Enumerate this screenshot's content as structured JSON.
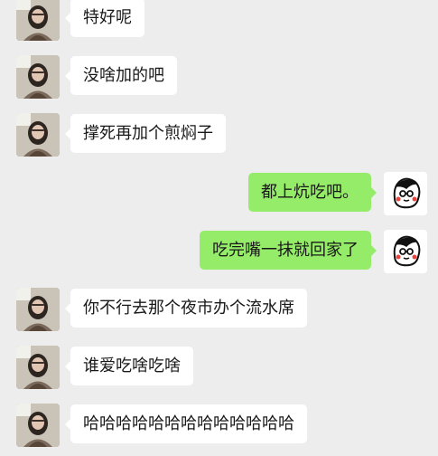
{
  "messages": [
    {
      "side": "left",
      "text": "特好呢",
      "avatar": "girl-avatar"
    },
    {
      "side": "left",
      "text": "没啥加的吧",
      "avatar": "girl-avatar"
    },
    {
      "side": "left",
      "text": "撑死再加个煎焖子",
      "avatar": "girl-avatar"
    },
    {
      "side": "right",
      "text": "都上炕吃吧。",
      "avatar": "cartoon-avatar"
    },
    {
      "side": "right",
      "text": "吃完嘴一抹就回家了",
      "avatar": "cartoon-avatar"
    },
    {
      "side": "left",
      "text": "你不行去那个夜市办个流水席",
      "avatar": "girl-avatar"
    },
    {
      "side": "left",
      "text": "谁爱吃啥吃啥",
      "avatar": "girl-avatar"
    },
    {
      "side": "left",
      "text": "哈哈哈哈哈哈哈哈哈哈哈哈哈",
      "avatar": "girl-avatar"
    }
  ],
  "colors": {
    "background": "#ededed",
    "incoming_bubble": "#ffffff",
    "outgoing_bubble": "#95ec69",
    "text": "#191919"
  }
}
